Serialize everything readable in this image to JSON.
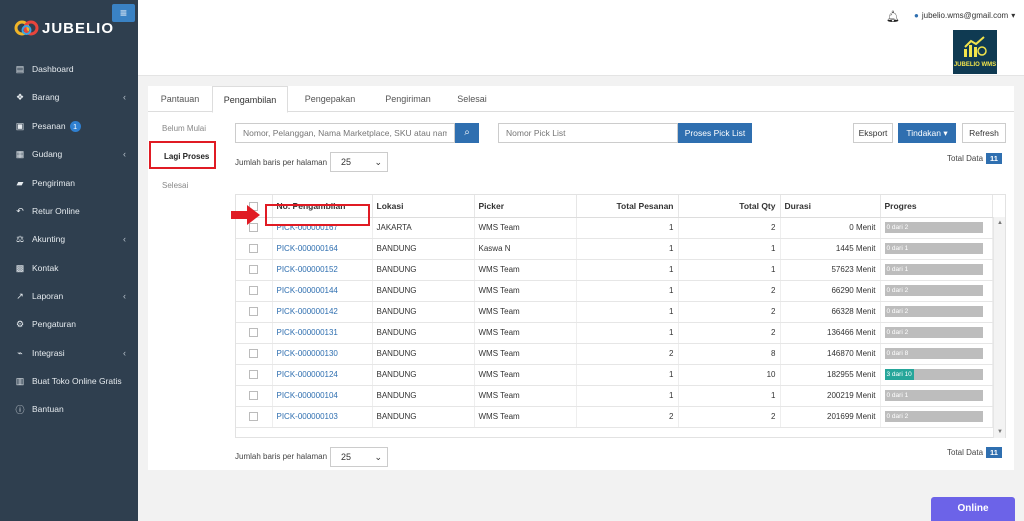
{
  "app": {
    "brand": "JUBELIO",
    "menu_toggle": "≡"
  },
  "sidebar": {
    "items": [
      {
        "label": "Dashboard",
        "icon": "chart-area-icon"
      },
      {
        "label": "Barang",
        "icon": "cubes-icon",
        "chevron": true
      },
      {
        "label": "Pesanan",
        "icon": "basket-icon",
        "badge": "1"
      },
      {
        "label": "Gudang",
        "icon": "building-icon",
        "chevron": true
      },
      {
        "label": "Pengiriman",
        "icon": "truck-icon"
      },
      {
        "label": "Retur Online",
        "icon": "reply-icon"
      },
      {
        "label": "Akunting",
        "icon": "balance-scale-icon",
        "chevron": true
      },
      {
        "label": "Kontak",
        "icon": "id-card-icon"
      },
      {
        "label": "Laporan",
        "icon": "line-chart-icon",
        "chevron": true
      },
      {
        "label": "Pengaturan",
        "icon": "cogs-icon"
      },
      {
        "label": "Integrasi",
        "icon": "plug-icon",
        "chevron": true
      },
      {
        "label": "Buat Toko Online Gratis",
        "icon": "cart-icon"
      },
      {
        "label": "Bantuan",
        "icon": "question-circle-icon"
      }
    ]
  },
  "header": {
    "user_email": "jubelio.wms@gmail.com",
    "wms_logo_text": "JUBELIO WMS"
  },
  "tabs": [
    "Pantauan",
    "Pengambilan",
    "Pengepakan",
    "Pengiriman",
    "Selesai"
  ],
  "substeps": [
    "Belum Mulai",
    "Lagi Proses",
    "Selesai"
  ],
  "toolbar": {
    "search_placeholder": "Nomor, Pelanggan, Nama Marketplace, SKU atau nama",
    "picklist_placeholder": "Nomor Pick List",
    "proses_label": "Proses Pick List",
    "ekspor_label": "Eksport",
    "tindakan_label": "Tindakan",
    "refresh_label": "Refresh"
  },
  "pagination": {
    "rows_label": "Jumlah baris per halaman",
    "rows_value": "25",
    "total_label": "Total Data",
    "total_value": "11"
  },
  "table": {
    "columns": [
      "No. Pengambilan",
      "Lokasi",
      "Picker",
      "Total Pesanan",
      "Total Qty",
      "Durasi",
      "Progres"
    ],
    "rows": [
      {
        "no": "PICK-000000167",
        "lokasi": "JAKARTA",
        "picker": "WMS Team",
        "pesanan": "1",
        "qty": "2",
        "durasi": "0 Menit",
        "progres": "0 dari 2",
        "pct": 0
      },
      {
        "no": "PICK-000000164",
        "lokasi": "BANDUNG",
        "picker": "Kaswa N",
        "pesanan": "1",
        "qty": "1",
        "durasi": "1445 Menit",
        "progres": "0 dari 1",
        "pct": 0
      },
      {
        "no": "PICK-000000152",
        "lokasi": "BANDUNG",
        "picker": "WMS Team",
        "pesanan": "1",
        "qty": "1",
        "durasi": "57623 Menit",
        "progres": "0 dari 1",
        "pct": 0
      },
      {
        "no": "PICK-000000144",
        "lokasi": "BANDUNG",
        "picker": "WMS Team",
        "pesanan": "1",
        "qty": "2",
        "durasi": "66290 Menit",
        "progres": "0 dari 2",
        "pct": 0
      },
      {
        "no": "PICK-000000142",
        "lokasi": "BANDUNG",
        "picker": "WMS Team",
        "pesanan": "1",
        "qty": "2",
        "durasi": "66328 Menit",
        "progres": "0 dari 2",
        "pct": 0
      },
      {
        "no": "PICK-000000131",
        "lokasi": "BANDUNG",
        "picker": "WMS Team",
        "pesanan": "1",
        "qty": "2",
        "durasi": "136466 Menit",
        "progres": "0 dari 2",
        "pct": 0
      },
      {
        "no": "PICK-000000130",
        "lokasi": "BANDUNG",
        "picker": "WMS Team",
        "pesanan": "2",
        "qty": "8",
        "durasi": "146870 Menit",
        "progres": "0 dari 8",
        "pct": 0
      },
      {
        "no": "PICK-000000124",
        "lokasi": "BANDUNG",
        "picker": "WMS Team",
        "pesanan": "1",
        "qty": "10",
        "durasi": "182955 Menit",
        "progres": "3 dari 10",
        "pct": 30
      },
      {
        "no": "PICK-000000104",
        "lokasi": "BANDUNG",
        "picker": "WMS Team",
        "pesanan": "1",
        "qty": "1",
        "durasi": "200219 Menit",
        "progres": "0 dari 1",
        "pct": 0
      },
      {
        "no": "PICK-000000103",
        "lokasi": "BANDUNG",
        "picker": "WMS Team",
        "pesanan": "2",
        "qty": "2",
        "durasi": "201699 Menit",
        "progres": "0 dari 2",
        "pct": 0
      }
    ]
  },
  "online_button": "Online",
  "colors": {
    "sidebar": "#2f3f4f",
    "primary": "#2f6fb0",
    "highlight": "#e01b24",
    "progress_fill": "#26a69a",
    "online": "#6c63e8"
  }
}
